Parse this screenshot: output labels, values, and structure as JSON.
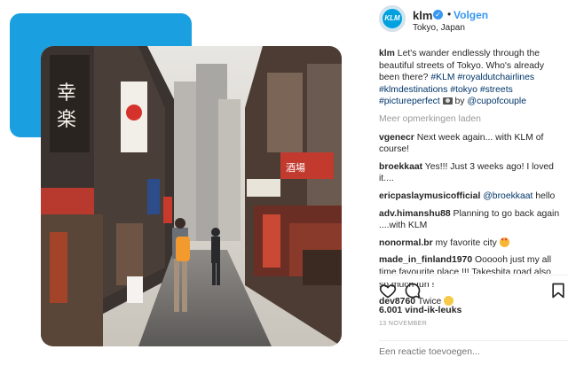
{
  "post": {
    "username": "klm",
    "follow_label": "Volgen",
    "location": "Tokyo, Japan",
    "avatar_text": "KLM",
    "caption": {
      "user": "klm",
      "text_1": "Let's wander endlessly through the beautiful streets of Tokyo. Who's already been there?",
      "tags": [
        "#KLM",
        "#royaldutchairlines",
        "#klmdestinations",
        "#tokyo",
        "#streets",
        "#pictureperfect"
      ],
      "by_text": "by",
      "mention": "@cupofcouple"
    },
    "load_more_label": "Meer opmerkingen laden",
    "comments": [
      {
        "user": "vgenecr",
        "text": "Next week again... with KLM of course!"
      },
      {
        "user": "broekkaat",
        "text": "Yes!!! Just 3 weeks ago! I loved it...."
      },
      {
        "user": "ericpaslaymusicofficial",
        "mention": "@broekkaat",
        "text": "hello"
      },
      {
        "user": "adv.himanshu88",
        "text": "Planning to go back again ....with KLM"
      },
      {
        "user": "nonormal.br",
        "text": "my favorite city"
      },
      {
        "user": "made_in_finland1970",
        "text": "Oooooh just my all time favourite place !!! Takeshita road also so much fun !"
      },
      {
        "user": "dev8760",
        "text": "Twice"
      }
    ],
    "likes": "6.001 vind-ik-leuks",
    "date": "13 NOVEMBER",
    "comment_placeholder": "Een reactie toevoegen..."
  },
  "colors": {
    "accent_blue": "#1a9fe0",
    "link_blue": "#3897f0",
    "hashtag": "#003569"
  },
  "icons": [
    "verified-badge-icon",
    "heart-icon",
    "comment-icon",
    "bookmark-icon"
  ]
}
